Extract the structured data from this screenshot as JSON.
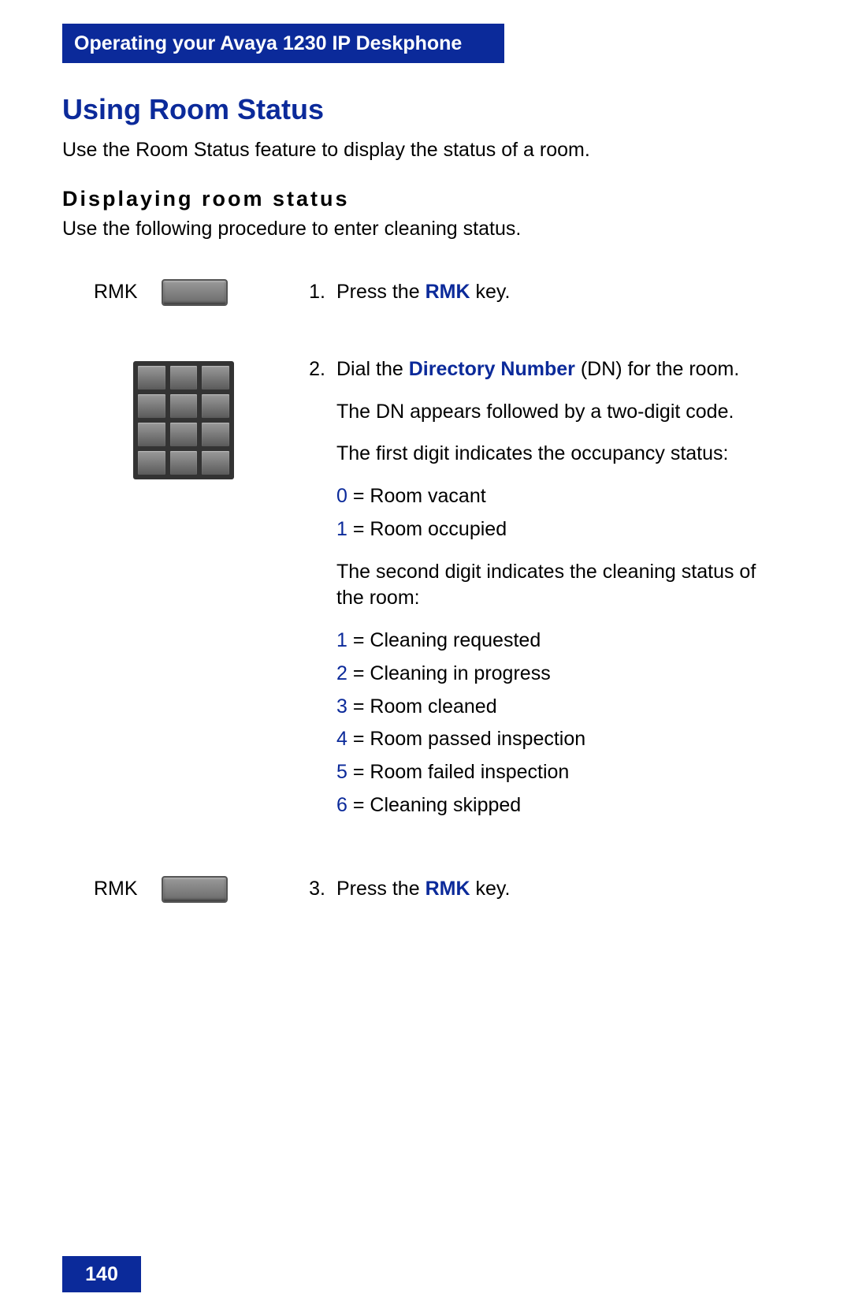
{
  "header": {
    "title": "Operating your Avaya 1230 IP Deskphone"
  },
  "section": {
    "title": "Using Room Status",
    "intro": "Use the Room Status feature to display the status of a room.",
    "subtitle": "Displaying room status",
    "sub_intro": "Use the following procedure to enter cleaning status."
  },
  "labels": {
    "rmk": "RMK"
  },
  "steps": {
    "s1": {
      "index": "1.",
      "pre": "Press the ",
      "bold": "RMK",
      "post": " key."
    },
    "s2": {
      "index": "2.",
      "line1_pre": "Dial the ",
      "line1_bold": "Directory Number",
      "line1_post": " (DN) for the room.",
      "line2": "The DN appears followed by a two-digit code.",
      "line3": "The first digit indicates the occupancy status:",
      "occ0_num": "0",
      "occ0_txt": " = Room vacant",
      "occ1_num": "1",
      "occ1_txt": " = Room occupied",
      "line4": "The second digit indicates the cleaning status of the room:",
      "c1_num": "1",
      "c1_txt": " = Cleaning requested",
      "c2_num": "2",
      "c2_txt": " = Cleaning in progress",
      "c3_num": "3",
      "c3_txt": " = Room cleaned",
      "c4_num": "4",
      "c4_txt": " = Room passed inspection",
      "c5_num": "5",
      "c5_txt": " = Room failed inspection",
      "c6_num": "6",
      "c6_txt": " = Cleaning skipped"
    },
    "s3": {
      "index": "3.",
      "pre": "Press the ",
      "bold": "RMK",
      "post": " key."
    }
  },
  "footer": {
    "page": "140"
  }
}
